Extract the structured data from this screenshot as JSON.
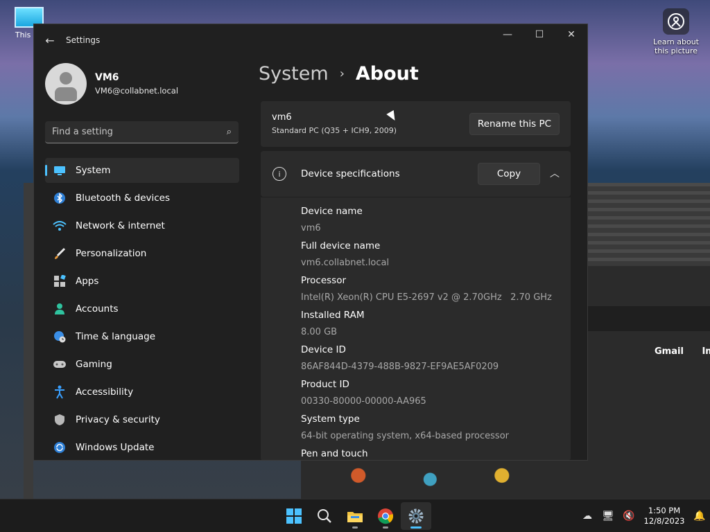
{
  "desktop": {
    "icon_label": "This PC",
    "spotlight_label": "Learn about this picture"
  },
  "background_browser": {
    "links": [
      "Gmail",
      "Images"
    ]
  },
  "window": {
    "title": "Settings"
  },
  "profile": {
    "name": "VM6",
    "email": "VM6@collabnet.local"
  },
  "search": {
    "placeholder": "Find a setting"
  },
  "nav": {
    "items": [
      {
        "label": "System",
        "icon": "monitor-icon"
      },
      {
        "label": "Bluetooth & devices",
        "icon": "bluetooth-icon"
      },
      {
        "label": "Network & internet",
        "icon": "wifi-icon"
      },
      {
        "label": "Personalization",
        "icon": "brush-icon"
      },
      {
        "label": "Apps",
        "icon": "apps-icon"
      },
      {
        "label": "Accounts",
        "icon": "person-icon"
      },
      {
        "label": "Time & language",
        "icon": "globe-clock-icon"
      },
      {
        "label": "Gaming",
        "icon": "gamepad-icon"
      },
      {
        "label": "Accessibility",
        "icon": "accessibility-icon"
      },
      {
        "label": "Privacy & security",
        "icon": "shield-icon"
      },
      {
        "label": "Windows Update",
        "icon": "update-icon"
      }
    ]
  },
  "breadcrumb": {
    "parent": "System",
    "current": "About"
  },
  "pc_card": {
    "name": "vm6",
    "model": "Standard PC (Q35 + ICH9, 2009)",
    "rename_label": "Rename this PC"
  },
  "specs": {
    "header_label": "Device specifications",
    "copy_label": "Copy",
    "rows": [
      {
        "key": "Device name",
        "value": "vm6"
      },
      {
        "key": "Full device name",
        "value": "vm6.collabnet.local"
      },
      {
        "key": "Processor",
        "value": "Intel(R) Xeon(R) CPU E5-2697 v2 @ 2.70GHz   2.70 GHz"
      },
      {
        "key": "Installed RAM",
        "value": "8.00 GB"
      },
      {
        "key": "Device ID",
        "value": "86AF844D-4379-488B-9827-EF9AE5AF0209"
      },
      {
        "key": "Product ID",
        "value": "00330-80000-00000-AA965"
      },
      {
        "key": "System type",
        "value": "64-bit operating system, x64-based processor"
      },
      {
        "key": "Pen and touch",
        "value": ""
      }
    ]
  },
  "taskbar": {
    "time": "1:50 PM",
    "date": "12/8/2023"
  },
  "colors": {
    "accent": "#4cc2ff",
    "window_bg": "#202020",
    "card_bg": "#2b2b2b"
  }
}
